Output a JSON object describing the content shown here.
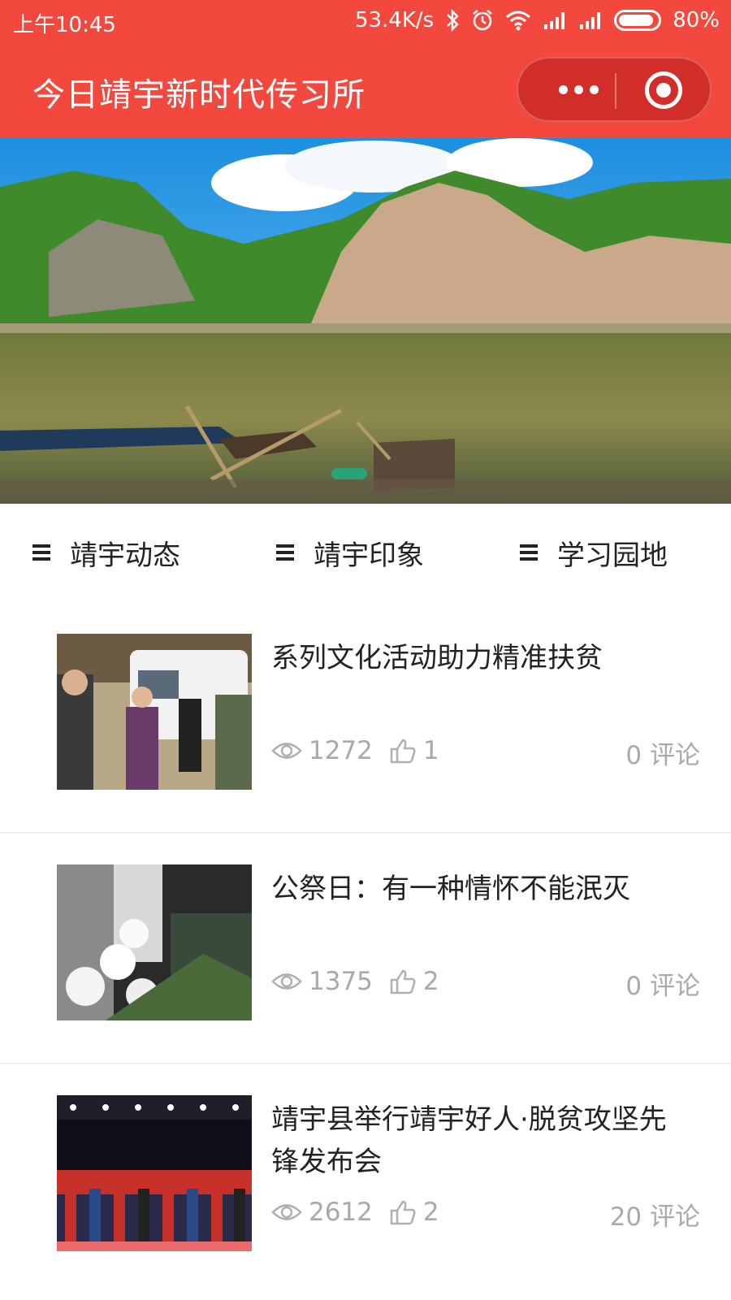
{
  "status_bar": {
    "time": "上午10:45",
    "speed": "53.4K/s",
    "battery": "80%"
  },
  "nav": {
    "title": "今日靖宇新时代传习所"
  },
  "tabs": [
    {
      "label": "靖宇动态"
    },
    {
      "label": "靖宇印象"
    },
    {
      "label": "学习园地"
    }
  ],
  "articles": [
    {
      "title": "系列文化活动助力精准扶贫",
      "views": "1272",
      "likes": "1",
      "comments": "0 评论"
    },
    {
      "title": "公祭日：有一种情怀不能泯灭",
      "views": "1375",
      "likes": "2",
      "comments": "0 评论"
    },
    {
      "title": "靖宇县举行靖宇好人·脱贫攻坚先锋发布会",
      "views": "2612",
      "likes": "2",
      "comments": "20 评论"
    }
  ],
  "colors": {
    "brand_red": "#f2483d",
    "carousel_active": "#2aa37a"
  }
}
